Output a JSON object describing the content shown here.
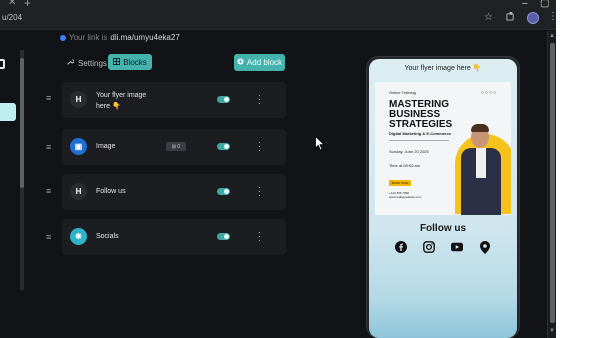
{
  "browser": {
    "address_text": "u/204",
    "close_glyph": "✕",
    "new_tab_glyph": "+",
    "window_controls": [
      "–",
      "▢",
      "✕"
    ],
    "icons": [
      "star-icon",
      "extensions-icon",
      "profile-avatar",
      "kebab-menu-icon"
    ]
  },
  "editor": {
    "link_label": "Your link is",
    "link_url": "dii.ma/umyu4eka27",
    "tabs": {
      "settings_label": "Settings",
      "blocks_label": "Blocks"
    },
    "add_block_label": "Add block",
    "blocks": [
      {
        "icon_glyph": "H",
        "label_line1": "Your flyer image",
        "label_line2": "here 👇",
        "toggle_on": true
      },
      {
        "icon_glyph": "▣",
        "label_line1": "Image",
        "badge": "⊞ 0",
        "toggle_on": true
      },
      {
        "icon_glyph": "H",
        "label_line1": "Follow us",
        "toggle_on": true
      },
      {
        "icon_glyph": "❋",
        "label_line1": "Socials",
        "toggle_on": true
      }
    ]
  },
  "preview": {
    "title": "Your flyer image here 👇",
    "flyer": {
      "top_label": "Online Training",
      "dots": "○○○○",
      "headline": "MASTERING BUSINESS STRATEGIES",
      "subhead": "Digital Marketing & E-Commerce",
      "date": "Sunday, June 20 2025",
      "time": "Time at 08:00 am",
      "book": "BOOK NOW",
      "contact_line1": "+123 456 7890",
      "contact_line2": "www.reallygreatsite.com"
    },
    "follow_title": "Follow us",
    "social_icons": [
      "facebook-icon",
      "instagram-icon",
      "youtube-icon",
      "location-icon"
    ]
  },
  "colors": {
    "accent": "#45b3ad",
    "background": "#121316",
    "card": "#1b1d20"
  }
}
